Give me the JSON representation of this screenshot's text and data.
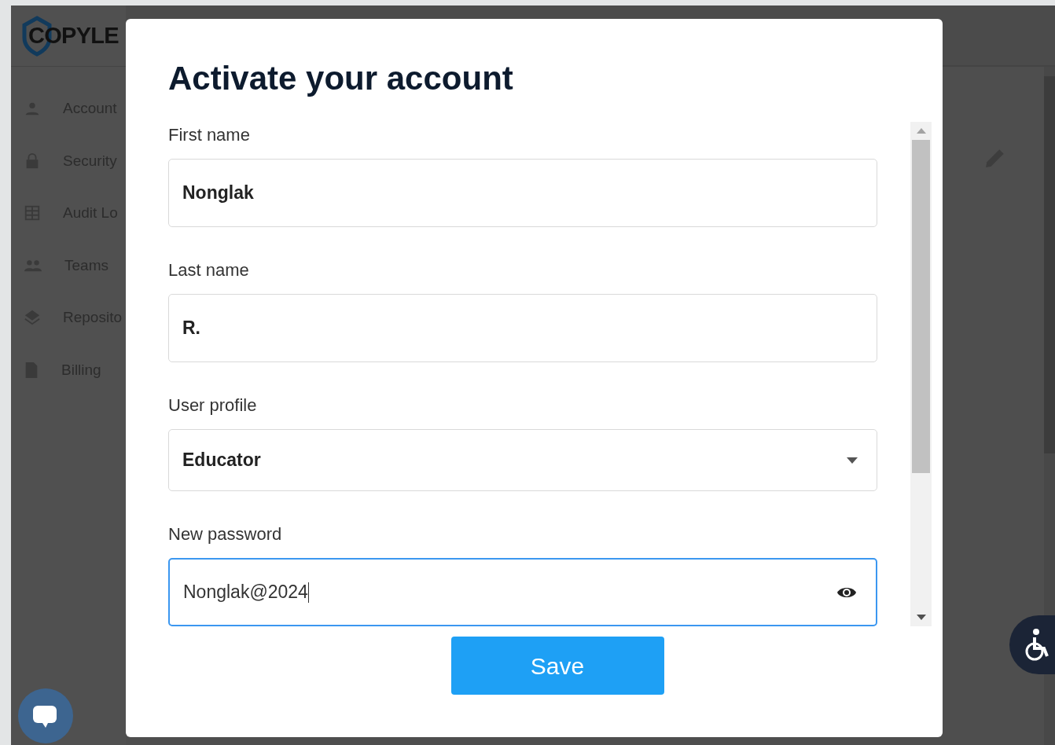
{
  "sidebar": {
    "logo": "COPYLE",
    "items": [
      {
        "label": "Account"
      },
      {
        "label": "Security"
      },
      {
        "label": "Audit Lo"
      },
      {
        "label": "Teams"
      },
      {
        "label": "Reposito"
      },
      {
        "label": "Billing"
      }
    ]
  },
  "dialog": {
    "title": "Activate your account",
    "fields": [
      {
        "kind": "text",
        "label": "First name",
        "value": "Nonglak",
        "focused": false
      },
      {
        "kind": "text",
        "label": "Last name",
        "value": "R.",
        "focused": false
      },
      {
        "kind": "select",
        "label": "User profile",
        "value": "Educator",
        "focused": false
      },
      {
        "kind": "password",
        "label": "New password",
        "value": "Nonglak@2024",
        "focused": true
      }
    ],
    "save_button": "Save"
  }
}
